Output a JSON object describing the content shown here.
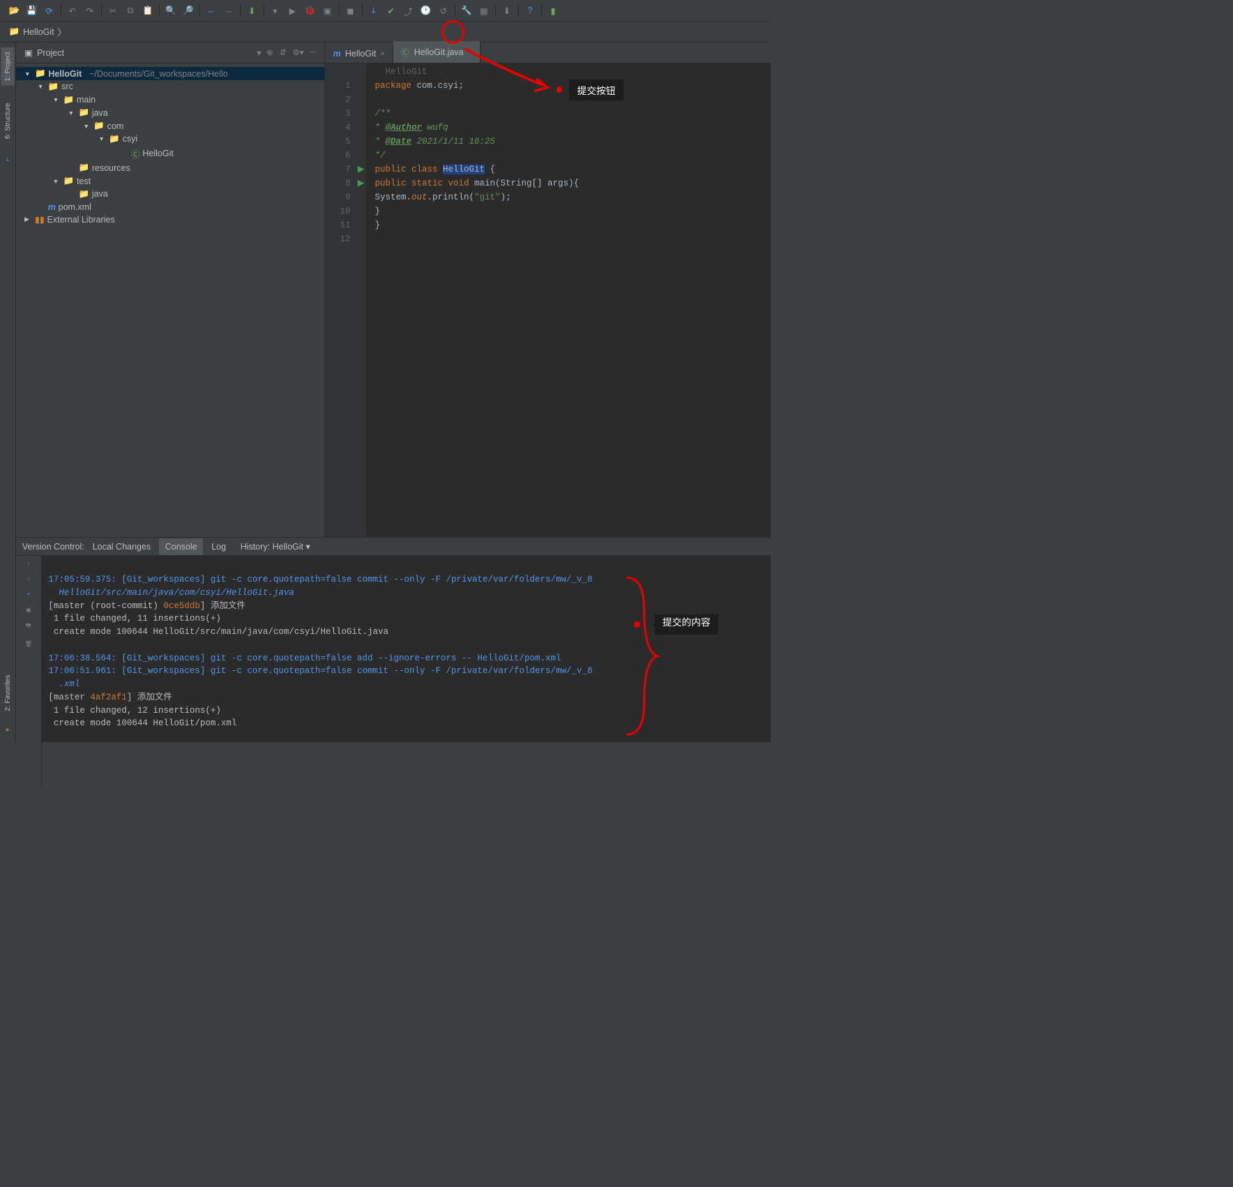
{
  "breadcrumb": {
    "project": "HelloGit"
  },
  "left_tabs": {
    "project": "1: Project",
    "structure": "6: Structure",
    "favorites": "2: Favorites"
  },
  "project_panel": {
    "title": "Project",
    "root": "HelloGit",
    "root_path": "~/Documents/Git_workspaces/Hello",
    "src": "src",
    "main": "main",
    "java": "java",
    "com": "com",
    "csyi": "csyi",
    "hellogit": "HelloGit",
    "resources": "resources",
    "test": "test",
    "test_java": "java",
    "pom": "pom.xml",
    "ext_libs": "External Libraries"
  },
  "editor": {
    "tab1": "HelloGit",
    "tab2": "HelloGit.java",
    "bc": "HelloGit",
    "lines": [
      "1",
      "2",
      "3",
      "4",
      "5",
      "6",
      "7",
      "8",
      "9",
      "10",
      "11",
      "12"
    ],
    "code": {
      "l1a": "package",
      "l1b": " com.csyi;",
      "l3": "/**",
      "l4a": " * ",
      "l4b": "@Author",
      "l4c": " wufq",
      "l5a": " * ",
      "l5b": "@Date",
      "l5c": " 2021/1/11 16:25",
      "l6": " */",
      "l7a": "public class ",
      "l7b": "HelloGit",
      "l7c": " {",
      "l8a": "    public static void ",
      "l8b": "main",
      "l8c": "(String[] args){",
      "l9a": "        System.",
      "l9b": "out",
      "l9c": ".println(",
      "l9d": "\"git\"",
      "l9e": ");",
      "l10": "    }",
      "l11": "}"
    }
  },
  "annotations": {
    "commit_btn": "提交按钮",
    "commit_content": "提交的内容"
  },
  "bottom": {
    "title": "Version Control:",
    "tab_local": "Local Changes",
    "tab_console": "Console",
    "tab_log": "Log",
    "tab_history": "History: HelloGit ▾",
    "console": {
      "l1": "17:05:59.375: [Git_workspaces] git -c core.quotepath=false commit --only -F /private/var/folders/mw/_v_8",
      "l2": "  HelloGit/src/main/java/com/csyi/HelloGit.java",
      "l3a": "[master (root-commit) ",
      "l3b": "0ce5ddb",
      "l3c": "] 添加文件",
      "l4": " 1 file changed, 11 insertions(+)",
      "l5": " create mode 100644 HelloGit/src/main/java/com/csyi/HelloGit.java",
      "l6": "17:06:38.564: [Git_workspaces] git -c core.quotepath=false add --ignore-errors -- HelloGit/pom.xml",
      "l7": "17:06:51.961: [Git_workspaces] git -c core.quotepath=false commit --only -F /private/var/folders/mw/_v_8",
      "l8": "  .xml",
      "l9a": "[master ",
      "l9b": "4af2af1",
      "l9c": "] 添加文件",
      "l10": " 1 file changed, 12 insertions(+)",
      "l11": " create mode 100644 HelloGit/pom.xml"
    }
  }
}
